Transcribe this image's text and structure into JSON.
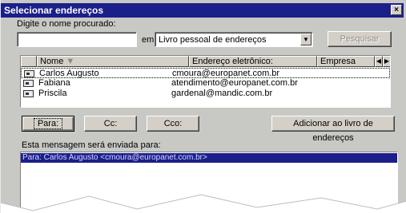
{
  "window": {
    "title": "Selecionar endereços",
    "close_glyph": "×"
  },
  "search": {
    "label": "Digite o nome procurado:",
    "value": "",
    "in_label": "em",
    "source_select": "Livro pessoal de endereços",
    "search_button": "Pesquisar"
  },
  "list": {
    "columns": [
      "Nome",
      "Endereço eletrônico:",
      "Empresa"
    ],
    "rows": [
      {
        "name": "Carlos Augusto",
        "email": "cmoura@europanet.com.br",
        "company": ""
      },
      {
        "name": "Fabiana",
        "email": "atendimento@europanet.com.br",
        "company": ""
      },
      {
        "name": "Priscila",
        "email": "gardenal@mandic.com.br",
        "company": ""
      }
    ]
  },
  "buttons": {
    "para": "Para:",
    "cc": "Cc:",
    "cco": "Cco:",
    "add_book": "Adicionar ao livro de endereços"
  },
  "recipients": {
    "label": "Esta mensagem será enviada para:",
    "entries": [
      "Para: Carlos Augusto <cmoura@europanet.com.br>"
    ]
  }
}
